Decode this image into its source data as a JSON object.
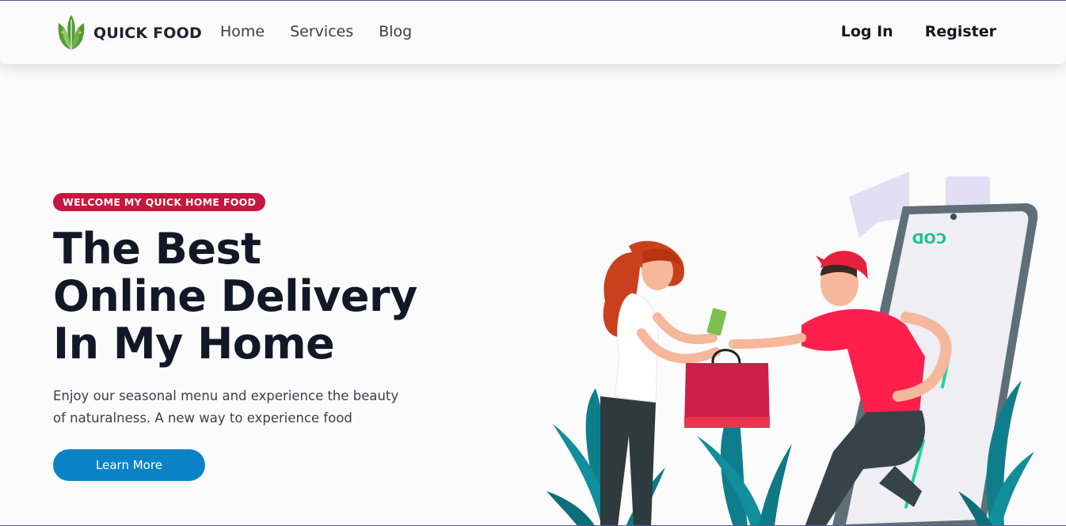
{
  "brand": {
    "name": "QUICK FOOD",
    "logo_icon": "leaf-logo-icon"
  },
  "nav": {
    "links": [
      {
        "label": "Home"
      },
      {
        "label": "Services"
      },
      {
        "label": "Blog"
      }
    ],
    "login_label": "Log In",
    "register_label": "Register"
  },
  "hero": {
    "badge": "WELCOME MY QUICK HOME FOOD",
    "title": "The Best Online Delivery In My Home",
    "description": "Enjoy our seasonal menu and experience the beauty of naturalness. A new way to experience food",
    "cta_label": "Learn More",
    "illustration": {
      "phone_screen_text": "COD",
      "icon": "delivery-illustration"
    }
  },
  "colors": {
    "accent_badge": "#c8173e",
    "cta": "#0b82c8",
    "title": "#121826"
  }
}
